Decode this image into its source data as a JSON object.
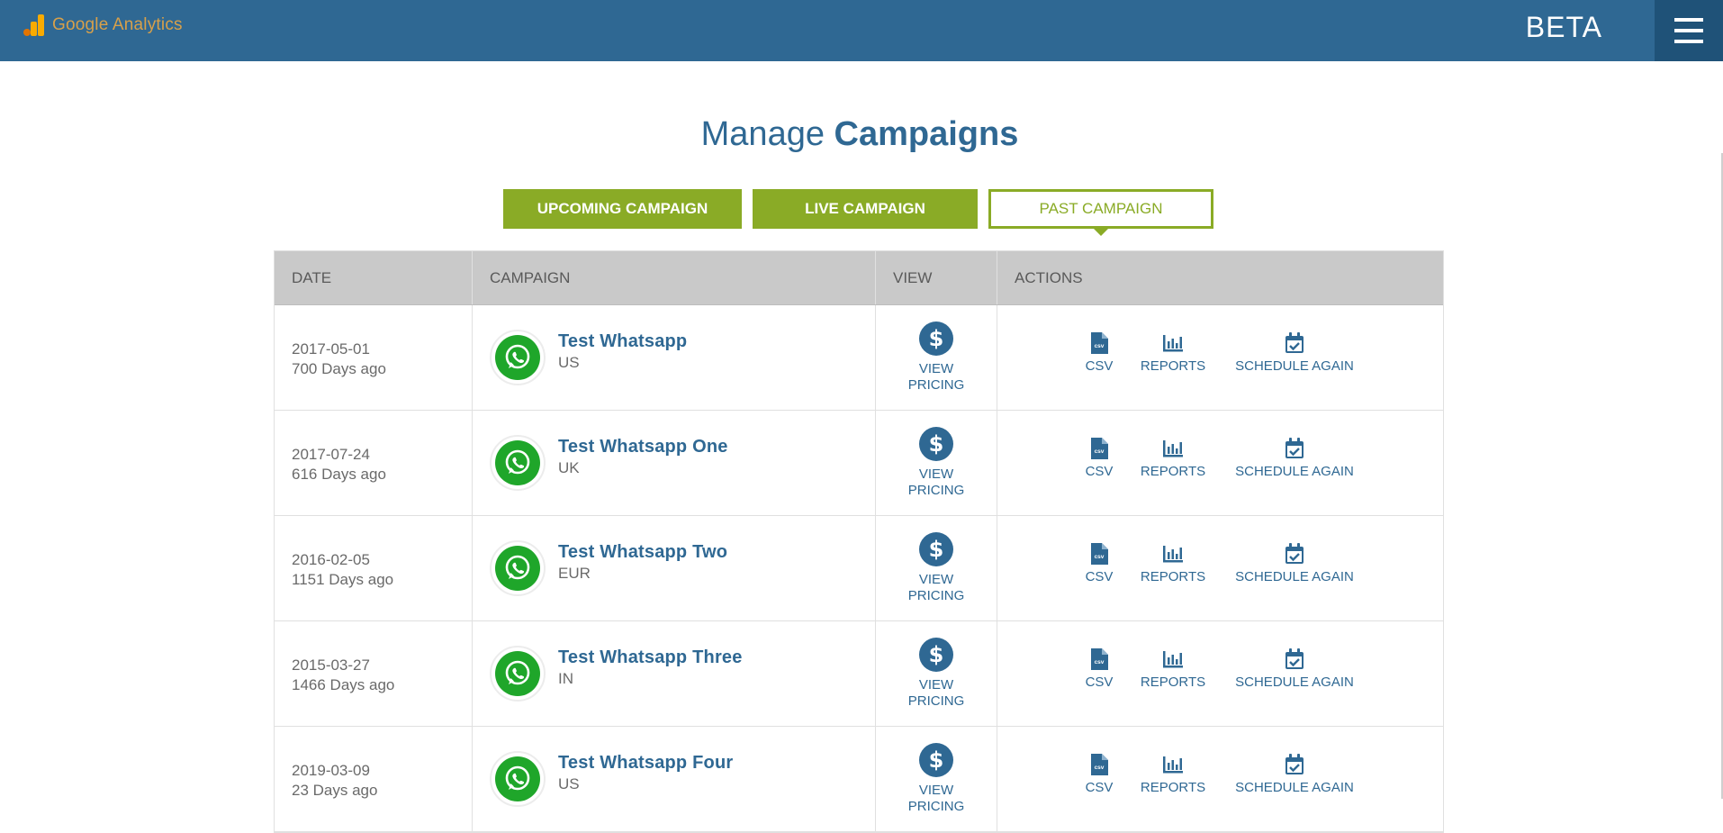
{
  "header": {
    "app_name": "Google Analytics",
    "badge": "BETA"
  },
  "page": {
    "title_light": "Manage",
    "title_bold": "Campaigns"
  },
  "tabs": [
    {
      "label": "UPCOMING CAMPAIGN",
      "active": false
    },
    {
      "label": "LIVE CAMPAIGN",
      "active": false
    },
    {
      "label": "PAST CAMPAIGN",
      "active": true
    }
  ],
  "table": {
    "columns": [
      "DATE",
      "CAMPAIGN",
      "VIEW",
      "ACTIONS"
    ],
    "view_label_line1": "VIEW",
    "view_label_line2": "PRICING",
    "action_labels": {
      "csv": "CSV",
      "reports": "REPORTS",
      "schedule": "SCHEDULE AGAIN"
    },
    "rows": [
      {
        "date": "2017-05-01",
        "ago": "700 Days ago",
        "name": "Test Whatsapp",
        "country": "US"
      },
      {
        "date": "2017-07-24",
        "ago": "616 Days ago",
        "name": "Test Whatsapp One",
        "country": "UK"
      },
      {
        "date": "2016-02-05",
        "ago": "1151 Days ago",
        "name": "Test Whatsapp Two",
        "country": "EUR"
      },
      {
        "date": "2015-03-27",
        "ago": "1466 Days ago",
        "name": "Test Whatsapp Three",
        "country": "IN"
      },
      {
        "date": "2019-03-09",
        "ago": "23 Days ago",
        "name": "Test Whatsapp Four",
        "country": "US"
      }
    ]
  },
  "icons": {
    "platform": "whatsapp-icon",
    "pricing": "dollar-icon",
    "csv": "csv-file-icon",
    "reports": "bar-chart-icon",
    "schedule": "calendar-check-icon",
    "menu": "hamburger-icon"
  },
  "colors": {
    "header_bg": "#2f6893",
    "menu_bg": "#1f5278",
    "accent_green": "#8aab26",
    "primary_blue": "#2f6893",
    "whatsapp_green": "#1fa62a",
    "table_header_bg": "#c9c9c9"
  }
}
